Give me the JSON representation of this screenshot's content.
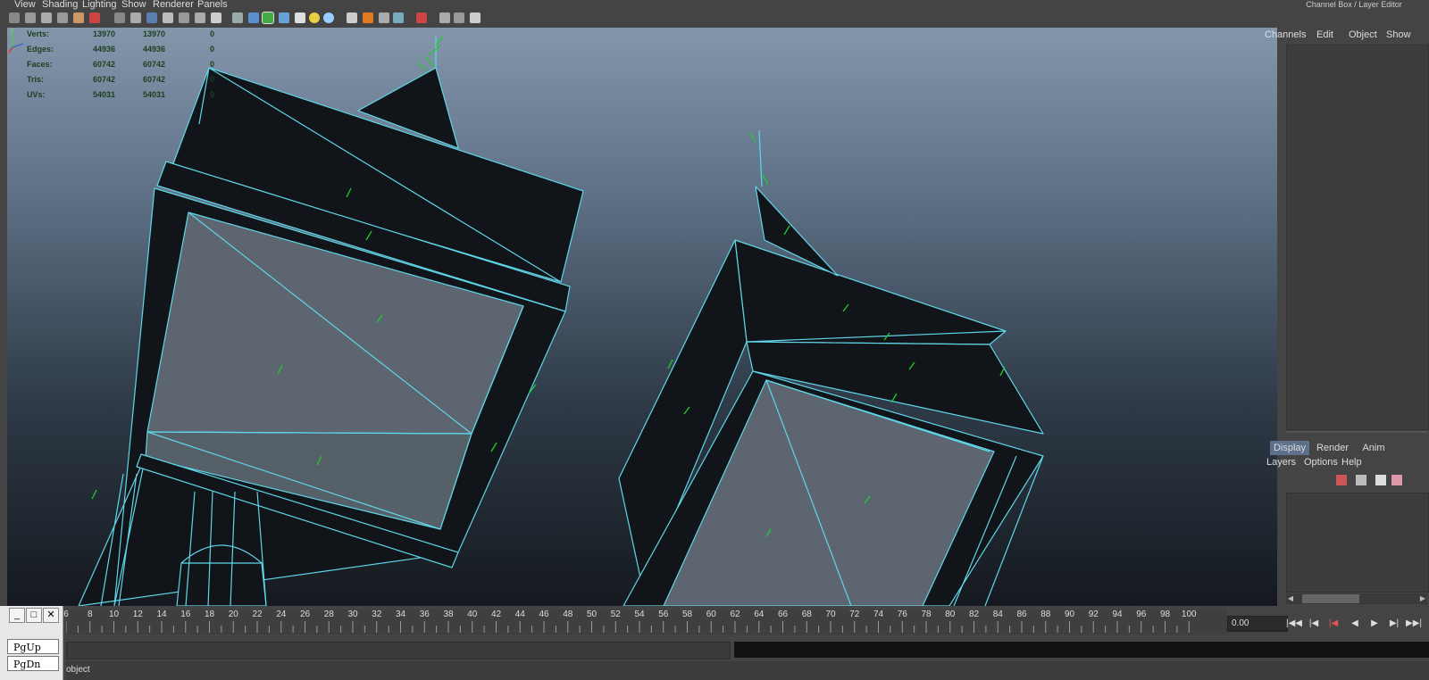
{
  "menubar": {
    "items": [
      "View",
      "Shading",
      "Lighting",
      "Show",
      "Renderer",
      "Panels"
    ]
  },
  "hud": {
    "rows": [
      {
        "label": "Verts:",
        "v1": "13970",
        "v2": "13970",
        "v3": "0"
      },
      {
        "label": "Edges:",
        "v1": "44936",
        "v2": "44936",
        "v3": "0"
      },
      {
        "label": "Faces:",
        "v1": "60742",
        "v2": "60742",
        "v3": "0"
      },
      {
        "label": "Tris:",
        "v1": "60742",
        "v2": "60742",
        "v3": "0"
      },
      {
        "label": "UVs:",
        "v1": "54031",
        "v2": "54031",
        "v3": "0"
      }
    ]
  },
  "axis": {
    "y": "y",
    "x": "x",
    "z": "z"
  },
  "right_panel": {
    "title": "Channel Box / Layer Editor",
    "channel_tabs": [
      "Channels",
      "Edit",
      "Object",
      "Show"
    ],
    "layer_tabs": [
      "Display",
      "Render",
      "Anim"
    ],
    "layer_menu": [
      "Layers",
      "Options",
      "Help"
    ]
  },
  "timeline": {
    "labels": [
      "6",
      "8",
      "10",
      "12",
      "14",
      "16",
      "18",
      "20",
      "22",
      "24",
      "26",
      "28",
      "30",
      "32",
      "34",
      "36",
      "38",
      "40",
      "42",
      "44",
      "46",
      "48",
      "50",
      "52",
      "54",
      "56",
      "58",
      "60",
      "62",
      "64",
      "66",
      "68",
      "70",
      "72",
      "74",
      "76",
      "78",
      "80",
      "82",
      "84",
      "86",
      "88",
      "90",
      "92",
      "94",
      "96",
      "98",
      "100"
    ],
    "current_time": "0.00"
  },
  "status": {
    "text": "object"
  },
  "osk": {
    "keys": [
      "PgUp",
      "PgDn"
    ]
  },
  "colors": {
    "wire": "#5fd6e8",
    "mesh": "#111418",
    "glass": "#5d6670",
    "normals": "#1fcc2a",
    "layer_tab_active": "#5d6f8a"
  }
}
